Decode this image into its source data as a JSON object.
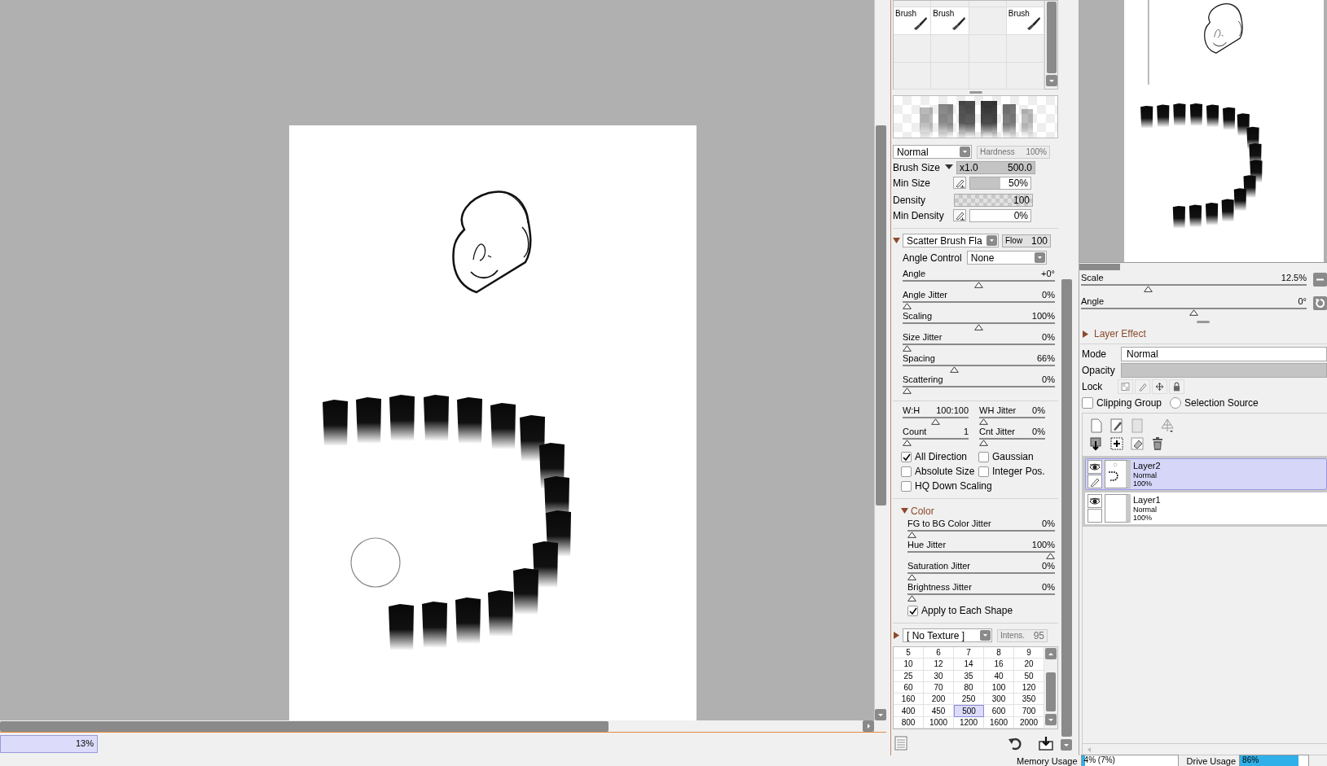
{
  "canvas": {
    "zoom": "13%"
  },
  "tool_palette": [
    {
      "kind": "brush",
      "label": "Brush"
    },
    {
      "kind": "brush",
      "label": "Brush"
    },
    {
      "kind": "empty"
    },
    {
      "kind": "brush",
      "label": "Brush"
    },
    {
      "kind": "empty"
    },
    {
      "kind": "empty"
    },
    {
      "kind": "empty"
    },
    {
      "kind": "empty"
    },
    {
      "kind": "empty"
    },
    {
      "kind": "empty"
    },
    {
      "kind": "empty"
    },
    {
      "kind": "empty"
    }
  ],
  "brush": {
    "blend_mode": "Normal",
    "hardness_label": "Hardness",
    "hardness": "100%",
    "size": {
      "label": "Brush Size",
      "multiplier": "x1.0",
      "value": "500.0",
      "level": 1
    },
    "min_size": {
      "label": "Min Size",
      "value": "50%",
      "level": 0.5
    },
    "density": {
      "label": "Density",
      "value": "100",
      "level": 1
    },
    "min_density": {
      "label": "Min Density",
      "value": "0%",
      "level": 0
    }
  },
  "scatter": {
    "expanded": true,
    "shape": "Scatter Brush Fla",
    "flow": {
      "label": "Flow",
      "value": "100",
      "level": 1
    },
    "angle_control_label": "Angle Control",
    "angle_control": "None",
    "sliders": [
      {
        "label": "Angle",
        "value": "+0°",
        "level": 0.5
      },
      {
        "label": "Angle Jitter",
        "value": "0%",
        "level": 0
      },
      {
        "label": "Scaling",
        "value": "100%",
        "level": 0.5
      },
      {
        "label": "Size Jitter",
        "value": "0%",
        "level": 0
      },
      {
        "label": "Spacing",
        "value": "66%",
        "level": 0.33
      },
      {
        "label": "Scattering",
        "value": "0%",
        "level": 0
      }
    ],
    "pairs": [
      [
        {
          "label": "W:H",
          "value": "100:100",
          "level": 0.5
        },
        {
          "label": "WH Jitter",
          "value": "0%",
          "level": 0
        }
      ],
      [
        {
          "label": "Count",
          "value": "1",
          "level": 0
        },
        {
          "label": "Cnt Jitter",
          "value": "0%",
          "level": 0
        }
      ]
    ],
    "checkboxes": [
      {
        "label": "All Direction",
        "checked": true
      },
      {
        "label": "Gaussian",
        "checked": false
      },
      {
        "label": "Absolute Size",
        "checked": false
      },
      {
        "label": "Integer Pos.",
        "checked": false
      },
      {
        "label": "HQ Down Scaling",
        "checked": false
      }
    ]
  },
  "color": {
    "label": "Color",
    "expanded": true,
    "sliders": [
      {
        "label": "FG to BG Color Jitter",
        "value": "0%",
        "level": 0
      },
      {
        "label": "Hue Jitter",
        "value": "100%",
        "level": 1
      },
      {
        "label": "Saturation Jitter",
        "value": "0%",
        "level": 0
      },
      {
        "label": "Brightness Jitter",
        "value": "0%",
        "level": 0
      }
    ],
    "apply": {
      "label": "Apply to Each Shape",
      "checked": true
    }
  },
  "texture": {
    "expanded": false,
    "name": "[ No Texture ]",
    "intensity_label": "Intens.",
    "intensity": "95"
  },
  "size_presets": [
    [
      {
        "value": "5",
        "selected": false
      },
      {
        "value": "6",
        "selected": false
      },
      {
        "value": "7",
        "selected": false
      },
      {
        "value": "8",
        "selected": false
      },
      {
        "value": "9",
        "selected": false
      }
    ],
    [
      {
        "value": "10",
        "selected": false
      },
      {
        "value": "12",
        "selected": false
      },
      {
        "value": "14",
        "selected": false
      },
      {
        "value": "16",
        "selected": false
      },
      {
        "value": "20",
        "selected": false
      }
    ],
    [
      {
        "value": "25",
        "selected": false
      },
      {
        "value": "30",
        "selected": false
      },
      {
        "value": "35",
        "selected": false
      },
      {
        "value": "40",
        "selected": false
      },
      {
        "value": "50",
        "selected": false
      }
    ],
    [
      {
        "value": "60",
        "selected": false
      },
      {
        "value": "70",
        "selected": false
      },
      {
        "value": "80",
        "selected": false
      },
      {
        "value": "100",
        "selected": false
      },
      {
        "value": "120",
        "selected": false
      }
    ],
    [
      {
        "value": "160",
        "selected": false
      },
      {
        "value": "200",
        "selected": false
      },
      {
        "value": "250",
        "selected": false
      },
      {
        "value": "300",
        "selected": false
      },
      {
        "value": "350",
        "selected": false
      }
    ],
    [
      {
        "value": "400",
        "selected": false
      },
      {
        "value": "450",
        "selected": false
      },
      {
        "value": "500",
        "selected": true
      },
      {
        "value": "600",
        "selected": false
      },
      {
        "value": "700",
        "selected": false
      }
    ],
    [
      {
        "value": "800",
        "selected": false
      },
      {
        "value": "1000",
        "selected": false
      },
      {
        "value": "1200",
        "selected": false
      },
      {
        "value": "1600",
        "selected": false
      },
      {
        "value": "2000",
        "selected": false
      }
    ]
  ],
  "navigator": {
    "scale": {
      "label": "Scale",
      "value": "12.5%",
      "level": 0.29
    },
    "angle": {
      "label": "Angle",
      "value": "0°",
      "level": 0.5
    }
  },
  "layer_effect": {
    "label": "Layer Effect",
    "expanded": false
  },
  "layer_props": {
    "mode_label": "Mode",
    "mode": "Normal",
    "opacity": {
      "label": "Opacity",
      "level": 1
    },
    "lock_label": "Lock",
    "clipping_group": {
      "label": "Clipping Group",
      "checked": false
    },
    "selection_source": {
      "label": "Selection Source",
      "checked": false
    }
  },
  "layers": [
    {
      "name": "Layer2",
      "mode": "Normal",
      "opacity": "100%",
      "selected": true,
      "visible": true,
      "editing": true
    },
    {
      "name": "Layer1",
      "mode": "Normal",
      "opacity": "100%",
      "selected": false,
      "visible": true,
      "editing": false
    }
  ],
  "status": {
    "memory": {
      "label": "Memory Usage",
      "value": "4% (7%)",
      "level": 0.04
    },
    "drive": {
      "label": "Drive Usage",
      "value": "86%",
      "level": 0.86
    }
  }
}
